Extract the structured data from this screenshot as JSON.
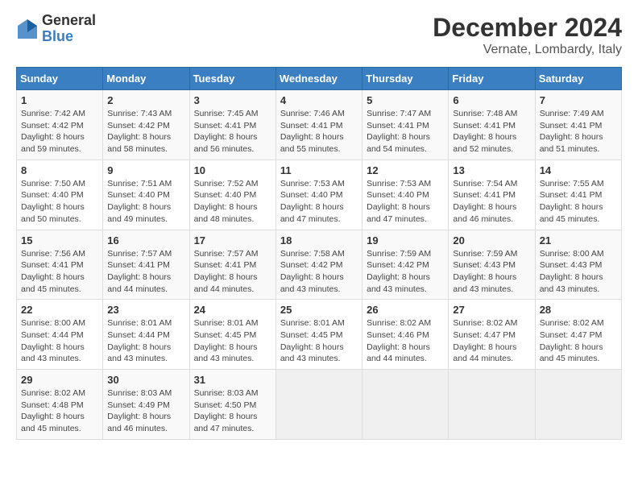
{
  "logo": {
    "general": "General",
    "blue": "Blue"
  },
  "header": {
    "title": "December 2024",
    "subtitle": "Vernate, Lombardy, Italy"
  },
  "weekdays": [
    "Sunday",
    "Monday",
    "Tuesday",
    "Wednesday",
    "Thursday",
    "Friday",
    "Saturday"
  ],
  "weeks": [
    [
      {
        "day": "1",
        "info": "Sunrise: 7:42 AM\nSunset: 4:42 PM\nDaylight: 8 hours\nand 59 minutes."
      },
      {
        "day": "2",
        "info": "Sunrise: 7:43 AM\nSunset: 4:42 PM\nDaylight: 8 hours\nand 58 minutes."
      },
      {
        "day": "3",
        "info": "Sunrise: 7:45 AM\nSunset: 4:41 PM\nDaylight: 8 hours\nand 56 minutes."
      },
      {
        "day": "4",
        "info": "Sunrise: 7:46 AM\nSunset: 4:41 PM\nDaylight: 8 hours\nand 55 minutes."
      },
      {
        "day": "5",
        "info": "Sunrise: 7:47 AM\nSunset: 4:41 PM\nDaylight: 8 hours\nand 54 minutes."
      },
      {
        "day": "6",
        "info": "Sunrise: 7:48 AM\nSunset: 4:41 PM\nDaylight: 8 hours\nand 52 minutes."
      },
      {
        "day": "7",
        "info": "Sunrise: 7:49 AM\nSunset: 4:41 PM\nDaylight: 8 hours\nand 51 minutes."
      }
    ],
    [
      {
        "day": "8",
        "info": "Sunrise: 7:50 AM\nSunset: 4:40 PM\nDaylight: 8 hours\nand 50 minutes."
      },
      {
        "day": "9",
        "info": "Sunrise: 7:51 AM\nSunset: 4:40 PM\nDaylight: 8 hours\nand 49 minutes."
      },
      {
        "day": "10",
        "info": "Sunrise: 7:52 AM\nSunset: 4:40 PM\nDaylight: 8 hours\nand 48 minutes."
      },
      {
        "day": "11",
        "info": "Sunrise: 7:53 AM\nSunset: 4:40 PM\nDaylight: 8 hours\nand 47 minutes."
      },
      {
        "day": "12",
        "info": "Sunrise: 7:53 AM\nSunset: 4:40 PM\nDaylight: 8 hours\nand 47 minutes."
      },
      {
        "day": "13",
        "info": "Sunrise: 7:54 AM\nSunset: 4:41 PM\nDaylight: 8 hours\nand 46 minutes."
      },
      {
        "day": "14",
        "info": "Sunrise: 7:55 AM\nSunset: 4:41 PM\nDaylight: 8 hours\nand 45 minutes."
      }
    ],
    [
      {
        "day": "15",
        "info": "Sunrise: 7:56 AM\nSunset: 4:41 PM\nDaylight: 8 hours\nand 45 minutes."
      },
      {
        "day": "16",
        "info": "Sunrise: 7:57 AM\nSunset: 4:41 PM\nDaylight: 8 hours\nand 44 minutes."
      },
      {
        "day": "17",
        "info": "Sunrise: 7:57 AM\nSunset: 4:41 PM\nDaylight: 8 hours\nand 44 minutes."
      },
      {
        "day": "18",
        "info": "Sunrise: 7:58 AM\nSunset: 4:42 PM\nDaylight: 8 hours\nand 43 minutes."
      },
      {
        "day": "19",
        "info": "Sunrise: 7:59 AM\nSunset: 4:42 PM\nDaylight: 8 hours\nand 43 minutes."
      },
      {
        "day": "20",
        "info": "Sunrise: 7:59 AM\nSunset: 4:43 PM\nDaylight: 8 hours\nand 43 minutes."
      },
      {
        "day": "21",
        "info": "Sunrise: 8:00 AM\nSunset: 4:43 PM\nDaylight: 8 hours\nand 43 minutes."
      }
    ],
    [
      {
        "day": "22",
        "info": "Sunrise: 8:00 AM\nSunset: 4:44 PM\nDaylight: 8 hours\nand 43 minutes."
      },
      {
        "day": "23",
        "info": "Sunrise: 8:01 AM\nSunset: 4:44 PM\nDaylight: 8 hours\nand 43 minutes."
      },
      {
        "day": "24",
        "info": "Sunrise: 8:01 AM\nSunset: 4:45 PM\nDaylight: 8 hours\nand 43 minutes."
      },
      {
        "day": "25",
        "info": "Sunrise: 8:01 AM\nSunset: 4:45 PM\nDaylight: 8 hours\nand 43 minutes."
      },
      {
        "day": "26",
        "info": "Sunrise: 8:02 AM\nSunset: 4:46 PM\nDaylight: 8 hours\nand 44 minutes."
      },
      {
        "day": "27",
        "info": "Sunrise: 8:02 AM\nSunset: 4:47 PM\nDaylight: 8 hours\nand 44 minutes."
      },
      {
        "day": "28",
        "info": "Sunrise: 8:02 AM\nSunset: 4:47 PM\nDaylight: 8 hours\nand 45 minutes."
      }
    ],
    [
      {
        "day": "29",
        "info": "Sunrise: 8:02 AM\nSunset: 4:48 PM\nDaylight: 8 hours\nand 45 minutes."
      },
      {
        "day": "30",
        "info": "Sunrise: 8:03 AM\nSunset: 4:49 PM\nDaylight: 8 hours\nand 46 minutes."
      },
      {
        "day": "31",
        "info": "Sunrise: 8:03 AM\nSunset: 4:50 PM\nDaylight: 8 hours\nand 47 minutes."
      },
      {
        "day": "",
        "info": ""
      },
      {
        "day": "",
        "info": ""
      },
      {
        "day": "",
        "info": ""
      },
      {
        "day": "",
        "info": ""
      }
    ]
  ]
}
